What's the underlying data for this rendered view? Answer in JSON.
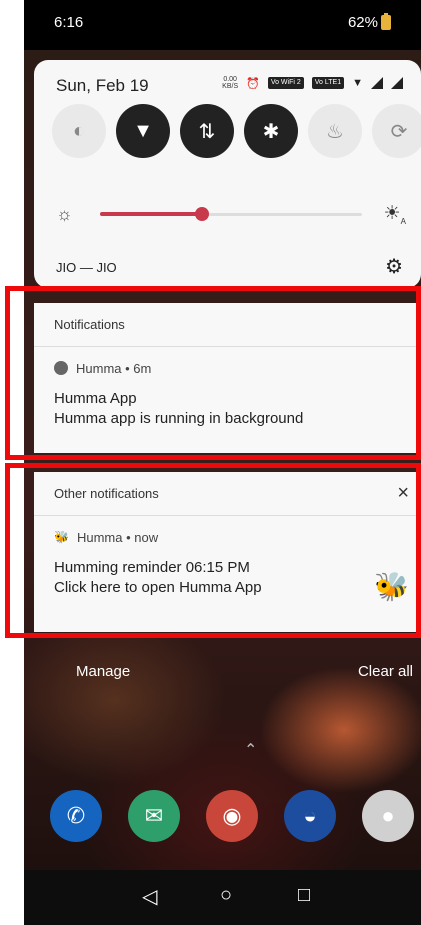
{
  "status": {
    "time": "6:16",
    "battery": "62%"
  },
  "quick_settings": {
    "date": "Sun, Feb 19",
    "net_speed": [
      "0.00",
      "KB/S"
    ],
    "sim_badges": [
      "Vo WiFi 2",
      "Vo LTE1"
    ],
    "tiles": [
      {
        "name": "data-saver-icon",
        "glyph": "◐",
        "state": "off"
      },
      {
        "name": "wifi-icon",
        "glyph": "▼",
        "state": "on"
      },
      {
        "name": "mobile-data-icon",
        "glyph": "⇅",
        "state": "on"
      },
      {
        "name": "bluetooth-icon",
        "glyph": "✱",
        "state": "on"
      },
      {
        "name": "flashlight-icon",
        "glyph": "♨",
        "state": "off"
      },
      {
        "name": "auto-rotate-icon",
        "glyph": "⟳",
        "state": "off"
      }
    ],
    "brightness_level": 0.39,
    "network_name": "JIO — JIO"
  },
  "notifications_card": {
    "header": "Notifications",
    "app_line": "Humma • 6m",
    "title": "Humma App",
    "body": "Humma app is running in background"
  },
  "other_card": {
    "header": "Other notifications",
    "close": "×",
    "app_line": "Humma • now",
    "title": "Humming reminder 06:15 PM",
    "body": "Click here to open Humma App"
  },
  "footer": {
    "manage": "Manage",
    "clear_all": "Clear all"
  },
  "dock": [
    {
      "name": "phone-app-icon",
      "color": "#1565c0",
      "glyph": "✆"
    },
    {
      "name": "messages-app-icon",
      "color": "#2e9e6b",
      "glyph": "✉"
    },
    {
      "name": "chrome-app-icon",
      "color": "#c8463a",
      "glyph": "◉"
    },
    {
      "name": "gallery-app-icon",
      "color": "#1d4d9e",
      "glyph": "◒"
    },
    {
      "name": "camera-app-icon",
      "color": "#d0d0d0",
      "glyph": "●"
    }
  ],
  "colors": {
    "accent": "#c8394b",
    "highlight": "#ee0a0a"
  }
}
